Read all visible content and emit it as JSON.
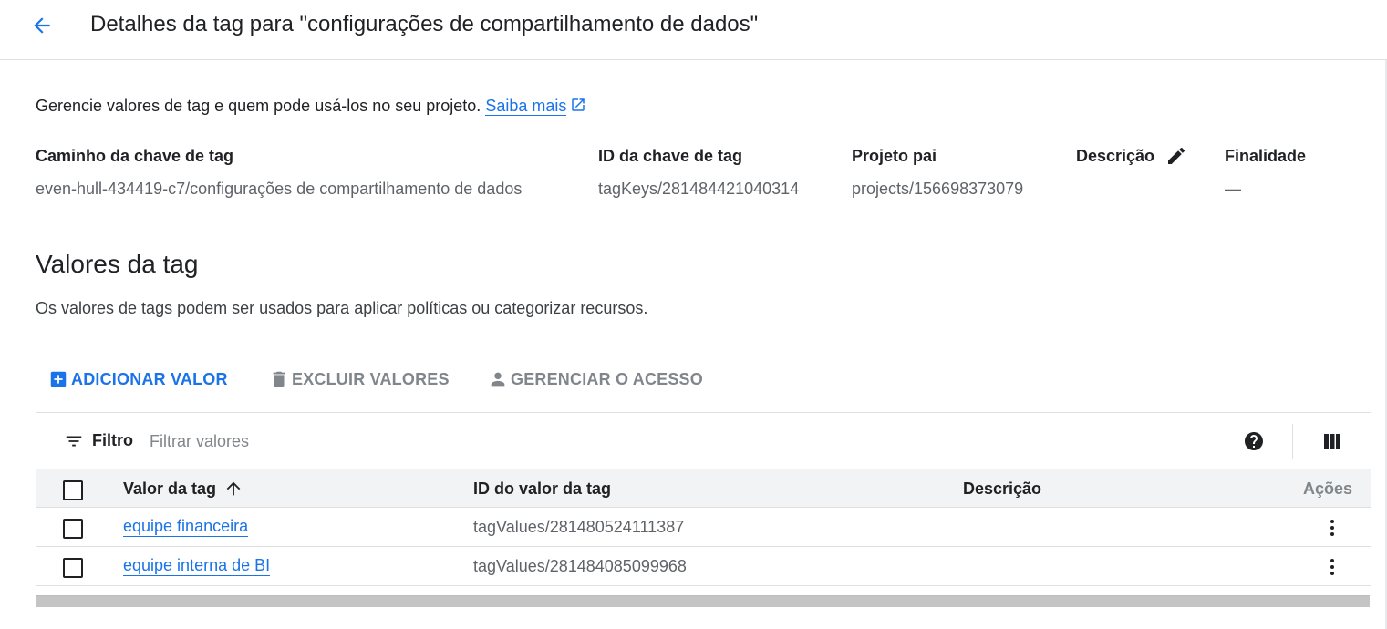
{
  "header": {
    "title": "Detalhes da tag para \"configurações de compartilhamento de dados\""
  },
  "intro": {
    "text": "Gerencie valores de tag e quem pode usá-los no seu projeto.",
    "link_label": "Saiba mais"
  },
  "details": {
    "path_label": "Caminho da chave de tag",
    "path_value": "even-hull-434419-c7/configurações de compartilhamento de dados",
    "key_id_label": "ID da chave de tag",
    "key_id_value": "tagKeys/281484421040314",
    "parent_label": "Projeto pai",
    "parent_value": "projects/156698373079",
    "description_label": "Descrição",
    "purpose_label": "Finalidade",
    "purpose_value": "—"
  },
  "values_section": {
    "title": "Valores da tag",
    "description": "Os valores de tags podem ser usados para aplicar políticas ou categorizar recursos."
  },
  "toolbar": {
    "add_label": "ADICIONAR VALOR",
    "delete_label": "EXCLUIR VALORES",
    "access_label": "GERENCIAR O ACESSO"
  },
  "filter": {
    "label": "Filtro",
    "placeholder": "Filtrar valores"
  },
  "table": {
    "columns": {
      "value": "Valor da tag",
      "id": "ID do valor da tag",
      "description": "Descrição",
      "actions": "Ações"
    },
    "sort": "ascending",
    "rows": [
      {
        "value": "equipe financeira",
        "id": "tagValues/281480524111387",
        "description": ""
      },
      {
        "value": "equipe interna de BI",
        "id": "tagValues/281484085099968",
        "description": ""
      }
    ]
  },
  "colors": {
    "accent": "#1a73e8",
    "text": "#202124",
    "muted": "#80868b",
    "header_bg": "#f1f3f4"
  },
  "icons": [
    "arrow-back-icon",
    "open-in-new-icon",
    "edit-pencil-icon",
    "add-box-icon",
    "trash-icon",
    "person-icon",
    "filter-list-icon",
    "help-circle-icon",
    "view-columns-icon",
    "arrow-upward-icon",
    "more-vert-icon"
  ]
}
